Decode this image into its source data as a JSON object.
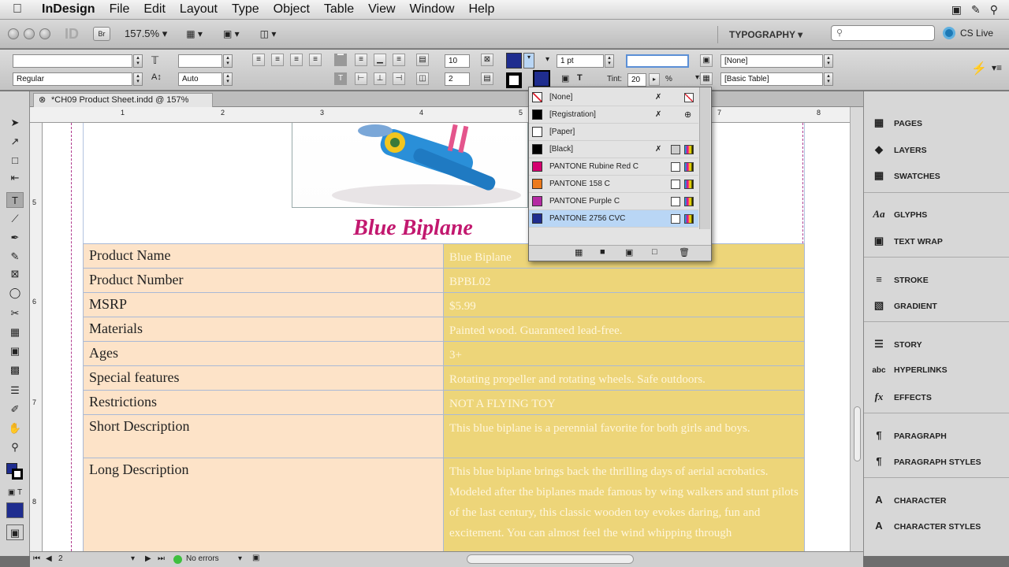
{
  "menubar": {
    "app": "InDesign",
    "items": [
      "File",
      "Edit",
      "Layout",
      "Type",
      "Object",
      "Table",
      "View",
      "Window",
      "Help"
    ]
  },
  "appbar": {
    "br_label": "Br",
    "zoom": "157.5%",
    "workspace": "TYPOGRAPHY",
    "cs_live": "CS Live"
  },
  "control": {
    "font_style": "Regular",
    "leading": "Auto",
    "rows": "10",
    "columns": "2",
    "stroke_weight": "1 pt",
    "tint_label": "Tint:",
    "tint_value": "20",
    "tint_unit": "%",
    "cell_style": "[None]",
    "table_style": "[Basic Table]"
  },
  "document": {
    "tab_title": "*CH09 Product Sheet.indd @ 157%"
  },
  "ruler": {
    "h_numbers": [
      "1",
      "2",
      "3",
      "4",
      "5",
      "6",
      "7",
      "8"
    ],
    "v_numbers": [
      "5",
      "6",
      "7",
      "8"
    ]
  },
  "page": {
    "title": "Blue Biplane",
    "table": [
      {
        "key": "Product Name",
        "value": "Blue Biplane"
      },
      {
        "key": "Product Number",
        "value": "BPBL02"
      },
      {
        "key": "MSRP",
        "value": "$5.99"
      },
      {
        "key": "Materials",
        "value": "Painted wood. Guaranteed lead-free."
      },
      {
        "key": "Ages",
        "value": "3+"
      },
      {
        "key": "Special features",
        "value": "Rotating propeller and rotating wheels. Safe outdoors."
      },
      {
        "key": "Restrictions",
        "value": "NOT A FLYING TOY"
      },
      {
        "key": "Short Description",
        "value": "This blue biplane is a perennial favorite for both girls and boys."
      },
      {
        "key": "Long Description",
        "value": "This blue biplane brings back the thrilling days of aerial acrobatics. Modeled after the biplanes made famous by wing walkers and stunt pilots of the last century, this classic wooden toy evokes daring, fun and excitement. You can almost feel the wind whipping through"
      }
    ]
  },
  "swatches": [
    {
      "name": "[None]",
      "color": "#ffffff"
    },
    {
      "name": "[Registration]",
      "color": "#000000"
    },
    {
      "name": "[Paper]",
      "color": "#ffffff"
    },
    {
      "name": "[Black]",
      "color": "#000000"
    },
    {
      "name": "PANTONE Rubine Red C",
      "color": "#d4006f"
    },
    {
      "name": "PANTONE 158 C",
      "color": "#ec7a1c"
    },
    {
      "name": "PANTONE Purple C",
      "color": "#b52aa3"
    },
    {
      "name": "PANTONE 2756 CVC",
      "color": "#1f2d8f"
    }
  ],
  "panels": {
    "pages": "PAGES",
    "layers": "LAYERS",
    "swatches": "SWATCHES",
    "glyphs": "GLYPHS",
    "text_wrap": "TEXT WRAP",
    "stroke": "STROKE",
    "gradient": "GRADIENT",
    "story": "STORY",
    "hyperlinks": "HYPERLINKS",
    "effects": "EFFECTS",
    "paragraph": "PARAGRAPH",
    "paragraph_styles": "PARAGRAPH STYLES",
    "character": "CHARACTER",
    "character_styles": "CHARACTER STYLES"
  },
  "status": {
    "page": "2",
    "preflight": "No errors"
  }
}
